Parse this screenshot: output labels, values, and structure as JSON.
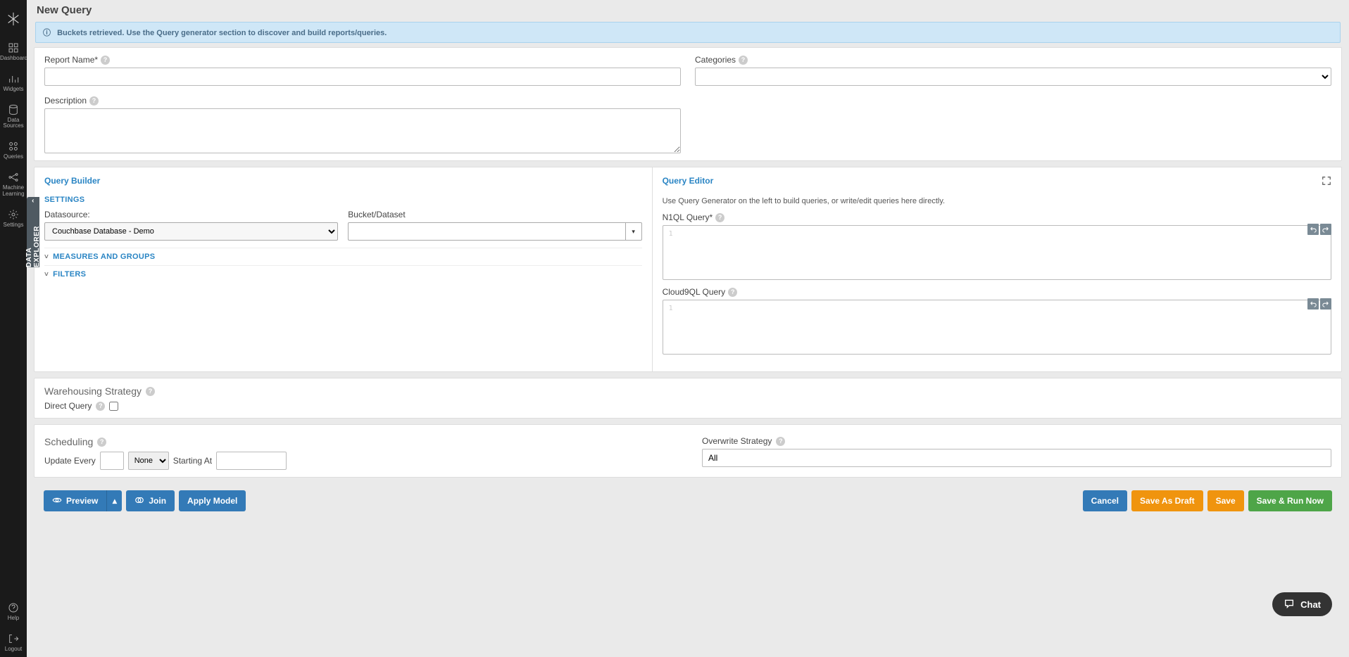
{
  "page_title": "New Query",
  "sidebar": {
    "items": [
      {
        "label": "Dashboards",
        "icon": "grid-icon"
      },
      {
        "label": "Widgets",
        "icon": "bar-chart-icon"
      },
      {
        "label": "Data Sources",
        "icon": "database-icon"
      },
      {
        "label": "Queries",
        "icon": "layers-icon"
      },
      {
        "label": "Machine Learning",
        "icon": "ml-icon"
      },
      {
        "label": "Settings",
        "icon": "gear-icon"
      }
    ],
    "bottom": [
      {
        "label": "Help",
        "icon": "help-icon"
      },
      {
        "label": "Logout",
        "icon": "logout-icon"
      }
    ]
  },
  "banner": {
    "text": "Buckets retrieved. Use the Query generator section to discover and build reports/queries."
  },
  "top_form": {
    "report_name_label": "Report Name*",
    "report_name_value": "",
    "categories_label": "Categories",
    "categories_value": "",
    "description_label": "Description",
    "description_value": ""
  },
  "builder": {
    "left_header": "Query Builder",
    "right_header": "Query Editor",
    "settings_heading": "SETTINGS",
    "datasource_label": "Datasource:",
    "datasource_value": "Couchbase Database - Demo",
    "bucket_label": "Bucket/Dataset",
    "bucket_value": "",
    "measures_heading": "MEASURES AND GROUPS",
    "filters_heading": "FILTERS",
    "editor_hint": "Use Query Generator on the left to build queries, or write/edit queries here directly.",
    "n1ql_label": "N1QL Query*",
    "n1ql_line": "1",
    "c9_label": "Cloud9QL Query",
    "c9_line": "1"
  },
  "warehouse": {
    "heading": "Warehousing Strategy",
    "direct_query_label": "Direct Query",
    "direct_query_checked": false
  },
  "scheduling": {
    "heading": "Scheduling",
    "update_every_label": "Update Every",
    "update_every_value": "",
    "update_unit": "None",
    "starting_at_label": "Starting At",
    "starting_at_value": "",
    "overwrite_label": "Overwrite Strategy",
    "overwrite_value": "All"
  },
  "actions": {
    "preview": "Preview",
    "join": "Join",
    "apply_model": "Apply Model",
    "cancel": "Cancel",
    "save_draft": "Save As Draft",
    "save": "Save",
    "save_run": "Save & Run Now"
  },
  "side_tab": "DATA EXPLORER",
  "chat": "Chat"
}
